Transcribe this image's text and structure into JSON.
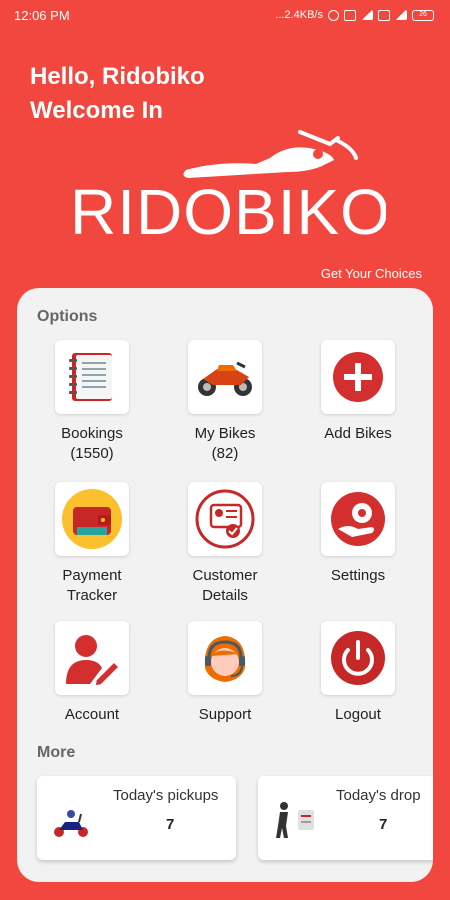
{
  "status": {
    "time": "12:06 PM",
    "network": "...2.4KB/s",
    "battery": "26"
  },
  "header": {
    "greeting": "Hello, Ridobiko",
    "welcome": "Welcome In",
    "brand": "RIDOBIKO",
    "tagline": "Get Your Choices"
  },
  "options": {
    "title": "Options",
    "items": [
      {
        "label": "Bookings",
        "sub": "(1550)",
        "icon": "notebook-icon"
      },
      {
        "label": "My Bikes",
        "sub": "(82)",
        "icon": "motorbike-icon"
      },
      {
        "label": "Add Bikes",
        "sub": "",
        "icon": "plus-circle-icon"
      },
      {
        "label": "Payment",
        "sub": "Tracker",
        "icon": "wallet-icon"
      },
      {
        "label": "Customer",
        "sub": "Details",
        "icon": "customer-id-icon"
      },
      {
        "label": "Settings",
        "sub": "",
        "icon": "settings-hand-icon"
      },
      {
        "label": "Account",
        "sub": "",
        "icon": "account-edit-icon"
      },
      {
        "label": "Support",
        "sub": "",
        "icon": "headset-agent-icon"
      },
      {
        "label": "Logout",
        "sub": "",
        "icon": "power-icon"
      }
    ]
  },
  "more": {
    "title": "More",
    "cards": [
      {
        "title": "Today's pickups",
        "count": "7",
        "icon": "scooter-rider-icon"
      },
      {
        "title": "Today's drop",
        "count": "7",
        "icon": "person-drop-icon"
      }
    ]
  },
  "colors": {
    "brand_red": "#f1473f",
    "icon_red": "#d32f2f",
    "card_bg": "#f2f2f2"
  }
}
